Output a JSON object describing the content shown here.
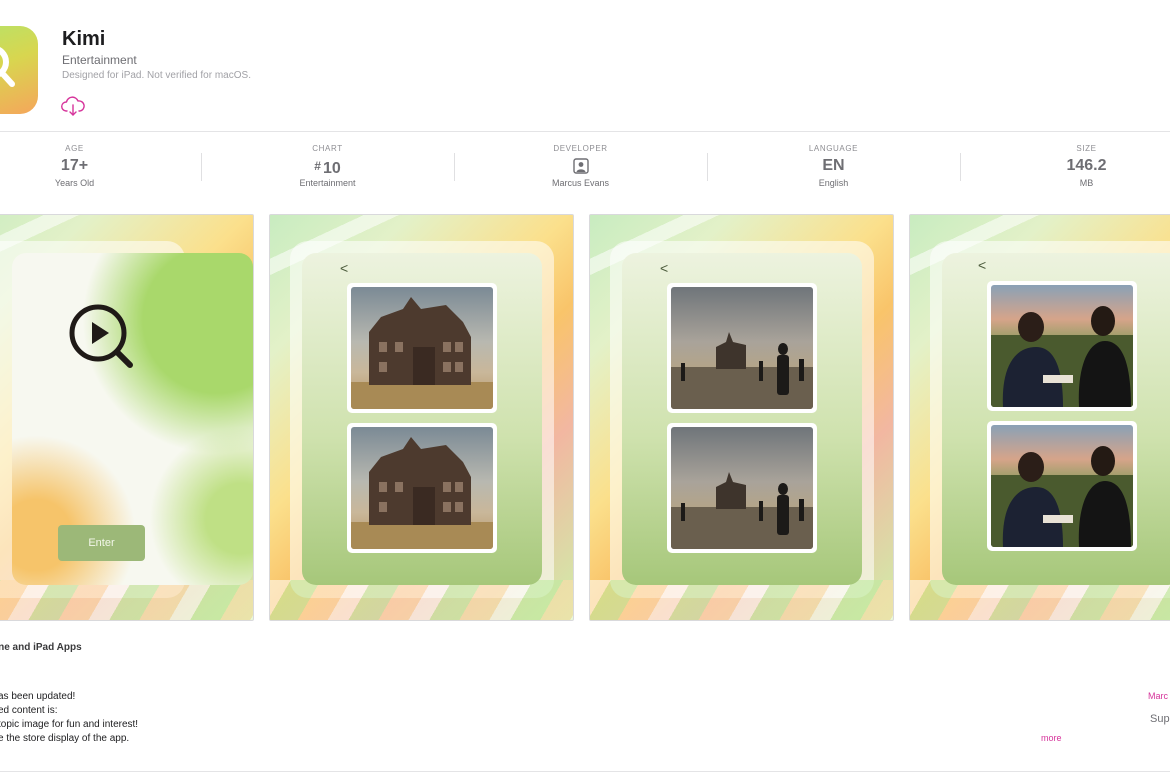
{
  "app": {
    "name": "Kimi",
    "category": "Entertainment",
    "note": "Designed for iPad. Not verified for macOS.",
    "download_icon": "cloud-download-icon",
    "accent_color": "#d6349b"
  },
  "info": [
    {
      "label": "AGE",
      "value": "17+",
      "sub": "Years Old"
    },
    {
      "label": "CHART",
      "hash": "#",
      "value": "10",
      "sub": "Entertainment"
    },
    {
      "label": "DEVELOPER",
      "icon": "developer-person-icon",
      "sub": "Marcus Evans"
    },
    {
      "label": "LANGUAGE",
      "value": "EN",
      "sub": "English"
    },
    {
      "label": "SIZE",
      "value": "146.2",
      "sub": "MB"
    }
  ],
  "screenshots": {
    "enter_label": "Enter",
    "back_glyph": "<"
  },
  "compat_label": "one and iPad Apps",
  "notes": [
    "as been updated!",
    "ed content is:",
    "topic image for fun and interest!",
    "e the store display of the app."
  ],
  "more_label": "more",
  "date_label": "Marc",
  "support_label": "Sup"
}
